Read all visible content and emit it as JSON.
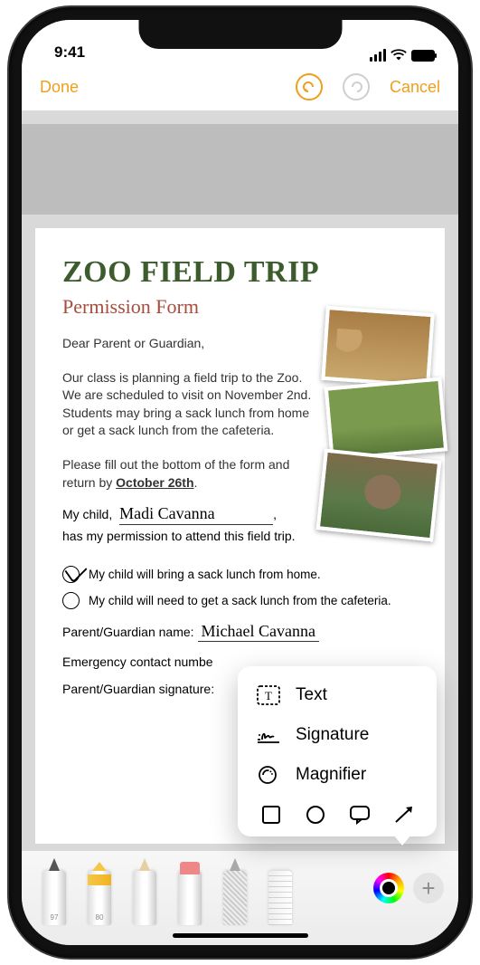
{
  "status": {
    "time": "9:41"
  },
  "nav": {
    "done": "Done",
    "cancel": "Cancel"
  },
  "document": {
    "title": "ZOO FIELD TRIP",
    "subtitle": "Permission Form",
    "salutation": "Dear Parent or Guardian,",
    "para1": "Our class is planning a field trip to the Zoo. We are scheduled to visit on November 2nd. Students may bring a sack lunch from home or get a sack lunch from the cafeteria.",
    "para2a": "Please fill out the bottom of the form and return by ",
    "para2_date": "October 26th",
    "mychild_label": "My child,",
    "child_name": "Madi Cavanna",
    "permission_tail": "has my permission to attend this field trip.",
    "cb1": "My child will bring a sack lunch from home.",
    "cb2": "My child will need to get a sack lunch from the cafeteria.",
    "parent_name_label": "Parent/Guardian name:",
    "parent_name_value": "Michael Cavanna",
    "emergency_label": "Emergency contact numbe",
    "signature_label": "Parent/Guardian signature:"
  },
  "popover": {
    "text": "Text",
    "signature": "Signature",
    "magnifier": "Magnifier"
  },
  "toolbar": {
    "pen_num": "97",
    "highlighter_num": "80"
  }
}
